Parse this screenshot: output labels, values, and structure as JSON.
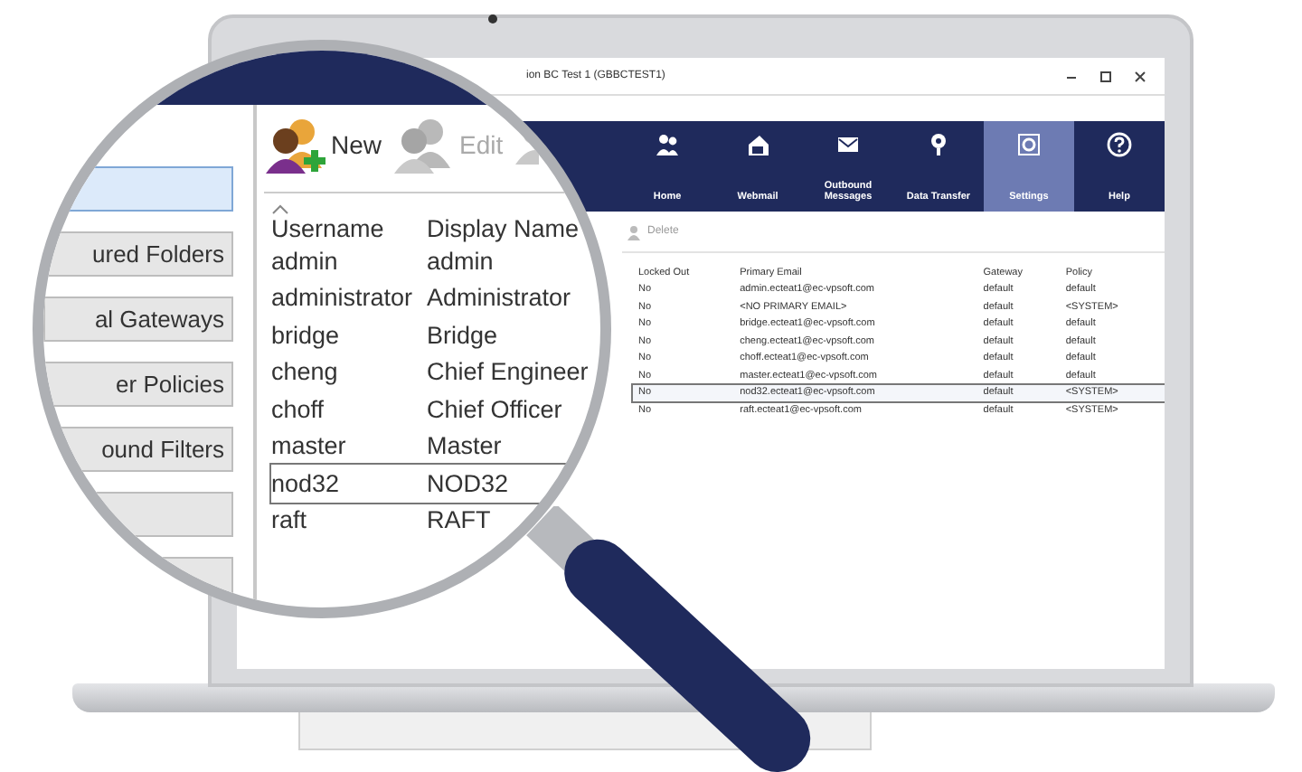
{
  "window": {
    "title": "ion BC Test 1 (GBBCTEST1)"
  },
  "ribbon": [
    {
      "label": "Home",
      "kind": "home",
      "selected": false
    },
    {
      "label": "Webmail",
      "kind": "webmail",
      "selected": false
    },
    {
      "label": "Outbound Messages",
      "kind": "outbound",
      "selected": false
    },
    {
      "label": "Data Transfer",
      "kind": "transfer",
      "selected": false
    },
    {
      "label": "Settings",
      "kind": "settings",
      "selected": true
    },
    {
      "label": "Help",
      "kind": "help",
      "selected": false
    }
  ],
  "toolbar": [
    {
      "label": "Delete",
      "disabled": true
    }
  ],
  "table": {
    "columns": [
      "Locked Out",
      "Primary Email",
      "Gateway",
      "Policy"
    ],
    "rows": [
      {
        "cells": [
          "No",
          "admin.ecteat1@ec-vpsoft.com",
          "default",
          "default"
        ],
        "selected": false
      },
      {
        "cells": [
          "No",
          "<NO PRIMARY EMAIL>",
          "default",
          "<SYSTEM>"
        ],
        "selected": false
      },
      {
        "cells": [
          "No",
          "bridge.ecteat1@ec-vpsoft.com",
          "default",
          "default"
        ],
        "selected": false
      },
      {
        "cells": [
          "No",
          "cheng.ecteat1@ec-vpsoft.com",
          "default",
          "default"
        ],
        "selected": false
      },
      {
        "cells": [
          "No",
          "choff.ecteat1@ec-vpsoft.com",
          "default",
          "default"
        ],
        "selected": false
      },
      {
        "cells": [
          "No",
          "master.ecteat1@ec-vpsoft.com",
          "default",
          "default"
        ],
        "selected": false
      },
      {
        "cells": [
          "No",
          "nod32.ecteat1@ec-vpsoft.com",
          "default",
          "<SYSTEM>"
        ],
        "selected": true
      },
      {
        "cells": [
          "No",
          "raft.ecteat1@ec-vpsoft.com",
          "default",
          "<SYSTEM>"
        ],
        "selected": false
      }
    ]
  },
  "magnifier": {
    "sidebar": [
      {
        "selected": true
      },
      {
        "label": "ured Folders",
        "selected": false
      },
      {
        "label": "al Gateways",
        "selected": false
      },
      {
        "label": "er Policies",
        "selected": false
      },
      {
        "label": "ound Filters",
        "selected": false
      },
      {
        "selected": false
      },
      {
        "selected": false
      }
    ],
    "toolbar": [
      {
        "label": "New",
        "kind": "new",
        "disabled": false
      },
      {
        "label": "Edit",
        "kind": "edit",
        "disabled": true
      },
      {
        "kind": "delete",
        "disabled": true
      }
    ],
    "list": {
      "columns": [
        "Username",
        "Display Name"
      ],
      "rows": [
        {
          "cells": [
            "admin",
            "admin"
          ],
          "selected": false
        },
        {
          "cells": [
            "administrator",
            "Administrator"
          ],
          "selected": false
        },
        {
          "cells": [
            "bridge",
            "Bridge"
          ],
          "selected": false
        },
        {
          "cells": [
            "cheng",
            "Chief Engineer"
          ],
          "selected": false
        },
        {
          "cells": [
            "choff",
            "Chief Officer"
          ],
          "selected": false
        },
        {
          "cells": [
            "master",
            "Master"
          ],
          "selected": false
        },
        {
          "cells": [
            "nod32",
            "NOD32"
          ],
          "selected": true
        },
        {
          "cells": [
            "raft",
            "RAFT"
          ],
          "selected": false
        }
      ]
    }
  }
}
